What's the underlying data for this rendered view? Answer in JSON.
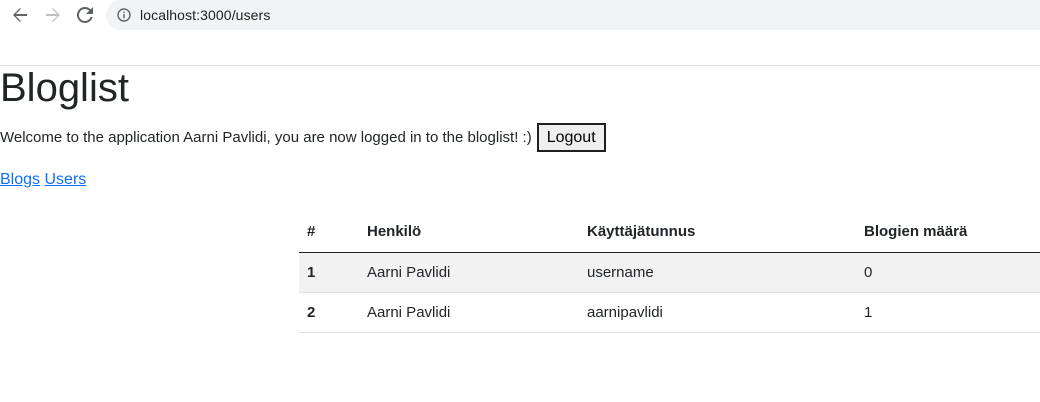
{
  "browser": {
    "url": "localhost:3000/users"
  },
  "page": {
    "title": "Bloglist",
    "welcome_text": "Welcome to the application Aarni Pavlidi, you are now logged in to the bloglist! :)",
    "logout_label": "Logout",
    "nav": {
      "blogs_label": "Blogs",
      "users_label": "Users"
    }
  },
  "users_table": {
    "headers": [
      "#",
      "Henkilö",
      "Käyttäjätunnus",
      "Blogien määrä"
    ],
    "rows": [
      {
        "index": "1",
        "name": "Aarni Pavlidi",
        "username": "username",
        "blog_count": "0"
      },
      {
        "index": "2",
        "name": "Aarni Pavlidi",
        "username": "aarnipavlidi",
        "blog_count": "1"
      }
    ]
  },
  "colors": {
    "link": "#0d6efd",
    "stripe": "#f2f2f2",
    "address_bar": "#f1f3f4"
  }
}
